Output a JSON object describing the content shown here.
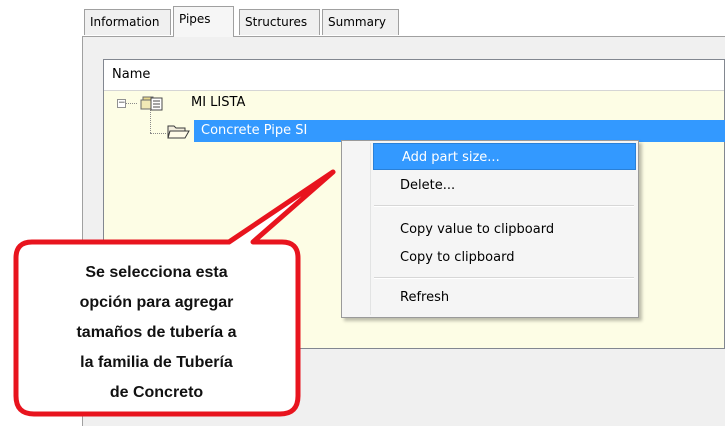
{
  "tabs": [
    "Information",
    "Pipes",
    "Structures",
    "Summary"
  ],
  "active_tab": "Pipes",
  "tree": {
    "column_header": "Name",
    "root": "MI LISTA",
    "child": "Concrete Pipe SI"
  },
  "context_menu": {
    "items": [
      "Add part size...",
      "Delete...",
      "Copy value to clipboard",
      "Copy to clipboard",
      "Refresh"
    ],
    "highlighted": "Add part size..."
  },
  "callout": {
    "lines": [
      "Se selecciona esta",
      "opción para agregar",
      "tamaños de tubería a",
      "la familia de Tubería",
      "de Concreto"
    ]
  },
  "colors": {
    "selection": "#3399ff",
    "tree_background": "#fdfde5",
    "callout_border": "#e8141e"
  }
}
